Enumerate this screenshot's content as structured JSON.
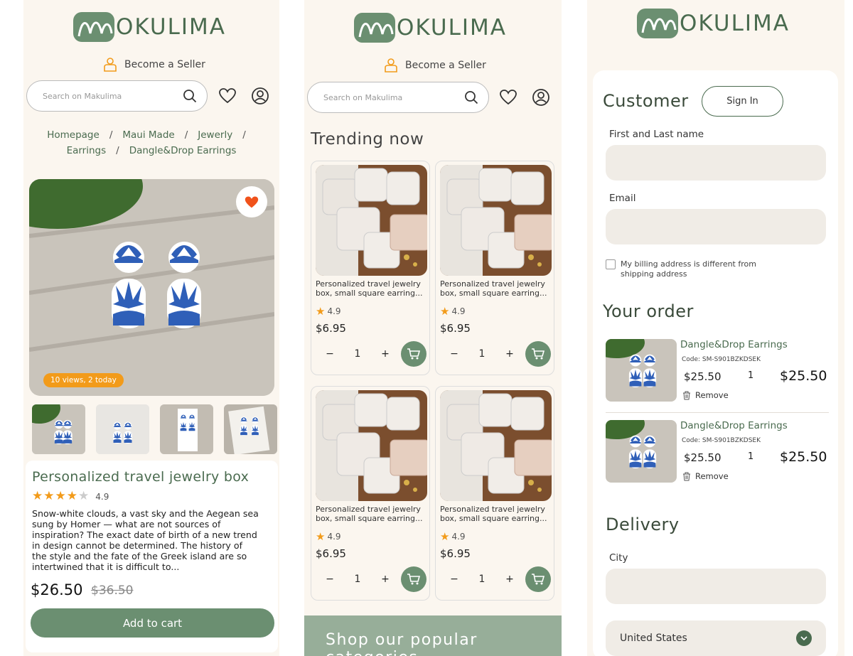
{
  "brand": {
    "logo_text": "OKULIMA",
    "accent": "#6b8f71",
    "dark_green": "#4a6b4f",
    "orange": "#f29b1a"
  },
  "header": {
    "become_seller": "Become a Seller",
    "search_placeholder": "Search on Makulima"
  },
  "product_page": {
    "breadcrumb": [
      "Homepage",
      "Maui Made",
      "Jewerly",
      "Earrings",
      "Dangle&Drop Earrings"
    ],
    "views_badge": "10 views, 2 today",
    "title": "Personalized travel jewelry box",
    "rating": "4.9",
    "rating_stars": 4,
    "description": "Snow-white clouds, a vast sky and the Aegean sea sung by Homer — what are not sources of inspiration? The exact date of birth of a new trend in design cannot be determined. The history of the style and the fate of the Greek island are so intertwined that it is difficult to...",
    "price": "$26.50",
    "old_price": "$36.50",
    "add_to_cart": "Add to cart"
  },
  "trending": {
    "title": "Trending now",
    "products": [
      {
        "name_line1": "Personalized travel jewelry",
        "name_line2": "box, small square earring...",
        "rating": "4.9",
        "price": "$6.95",
        "qty": "1"
      },
      {
        "name_line1": "Personalized travel jewelry",
        "name_line2": "box, small square earring...",
        "rating": "4.9",
        "price": "$6.95",
        "qty": "1"
      },
      {
        "name_line1": "Personalized travel jewelry",
        "name_line2": "box, small square earring...",
        "rating": "4.9",
        "price": "$6.95",
        "qty": "1"
      },
      {
        "name_line1": "Personalized travel jewelry",
        "name_line2": "box, small square earring...",
        "rating": "4.9",
        "price": "$6.95",
        "qty": "1"
      }
    ],
    "stepper_minus": "−",
    "stepper_plus": "+",
    "categories_banner": "Shop our popular categories"
  },
  "checkout": {
    "customer_title": "Customer",
    "sign_in": "Sign In",
    "name_label": "First and Last name",
    "email_label": "Email",
    "billing_checkbox": "My billing address is different from shipping address",
    "order_title": "Your order",
    "items": [
      {
        "name": "Dangle&Drop Earrings",
        "code": "Code: SM-S901BZKDSEK",
        "price": "$25.50",
        "qty": "1",
        "total": "$25.50",
        "remove": "Remove"
      },
      {
        "name": "Dangle&Drop Earrings",
        "code": "Code: SM-S901BZKDSEK",
        "price": "$25.50",
        "qty": "1",
        "total": "$25.50",
        "remove": "Remove"
      }
    ],
    "delivery_title": "Delivery",
    "city_label": "City",
    "country_value": "United States"
  }
}
